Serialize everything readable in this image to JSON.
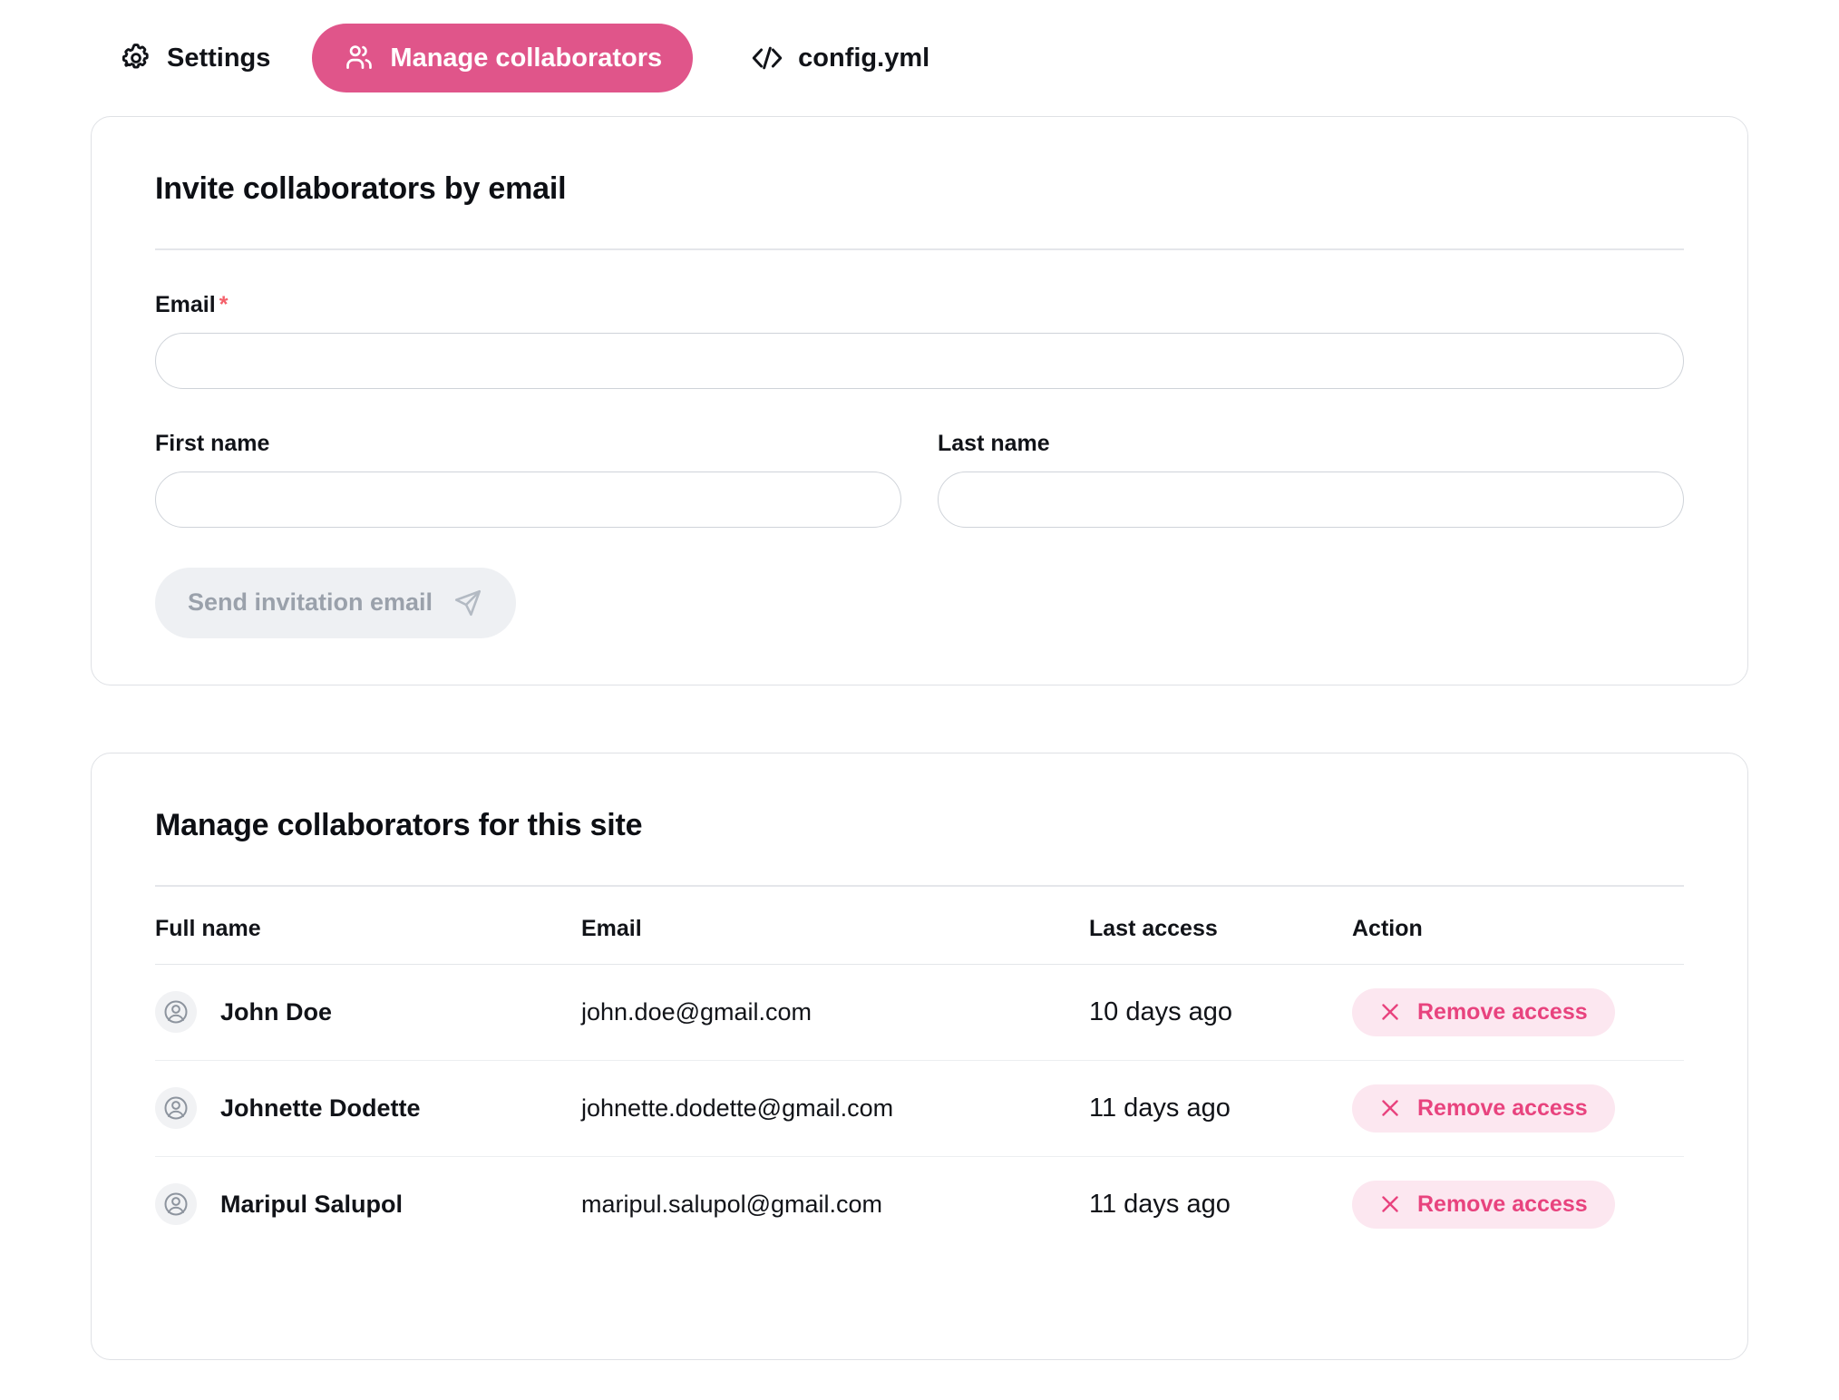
{
  "colors": {
    "accent_pink": "#e0558a",
    "remove_pink_text": "#e8437e",
    "remove_pink_bg": "#fce7f0",
    "required_red": "#f4606a",
    "disabled_bg": "#eef0f3",
    "disabled_text": "#9aa1ab",
    "card_border": "#dfe1e5"
  },
  "tabs": [
    {
      "label": "Settings",
      "icon": "gear-icon",
      "active": false
    },
    {
      "label": "Manage collaborators",
      "icon": "users-icon",
      "active": true
    },
    {
      "label": "config.yml",
      "icon": "code-icon",
      "active": false
    }
  ],
  "invite_card": {
    "title": "Invite collaborators by email",
    "email_label": "Email",
    "email_required_mark": "*",
    "email_value": "",
    "email_placeholder": "",
    "first_name_label": "First name",
    "first_name_value": "",
    "first_name_placeholder": "",
    "last_name_label": "Last name",
    "last_name_value": "",
    "last_name_placeholder": "",
    "send_button_label": "Send invitation email",
    "send_button_icon": "send-icon"
  },
  "manage_card": {
    "title": "Manage collaborators for this site",
    "columns": [
      "Full name",
      "Email",
      "Last access",
      "Action"
    ],
    "rows": [
      {
        "full_name": "John Doe",
        "email": "john.doe@gmail.com",
        "last_access": "10 days ago",
        "action_label": "Remove access",
        "action_icon": "close-icon"
      },
      {
        "full_name": "Johnette Dodette",
        "email": "johnette.dodette@gmail.com",
        "last_access": "11 days ago",
        "action_label": "Remove access",
        "action_icon": "close-icon"
      },
      {
        "full_name": "Maripul Salupol",
        "email": "maripul.salupol@gmail.com",
        "last_access": "11 days ago",
        "action_label": "Remove access",
        "action_icon": "close-icon"
      }
    ]
  }
}
